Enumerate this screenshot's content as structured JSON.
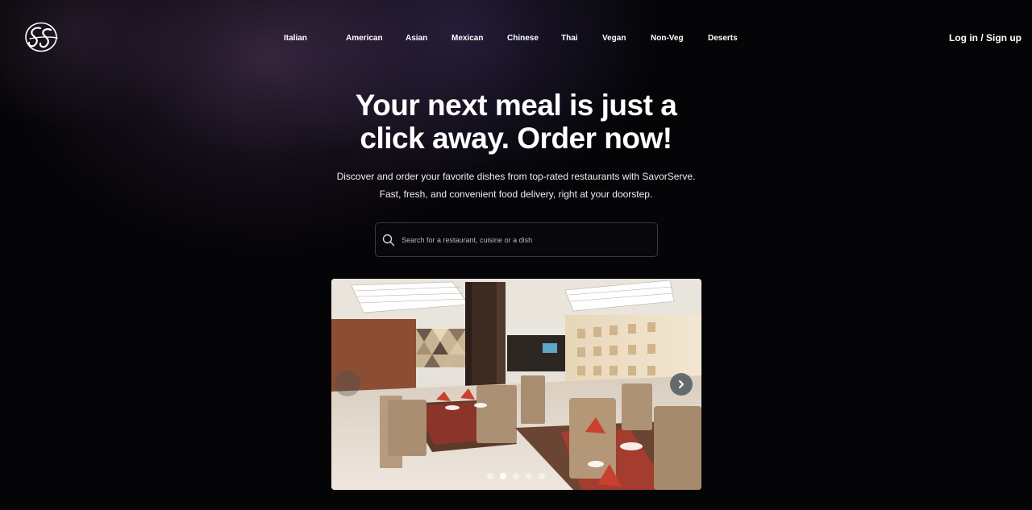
{
  "brand": {
    "logo_icon": "script-ss-logo-icon"
  },
  "nav": {
    "links": [
      "Italian",
      "American",
      "Asian",
      "Mexican",
      "Chinese",
      "Thai",
      "Vegan",
      "Non-Veg",
      "Deserts"
    ],
    "login_label": "Log in / Sign up"
  },
  "hero": {
    "title_line1": "Your next meal is just a",
    "title_line2": "click away. Order now!",
    "subtitle_line1": "Discover and order your favorite dishes from top-rated restaurants with SavorServe.",
    "subtitle_line2": "Fast, fresh, and convenient food delivery, right at your doorstep."
  },
  "search": {
    "placeholder": "Search for a restaurant, cuisine or a dish",
    "value": "",
    "icon": "search-icon"
  },
  "carousel": {
    "slide_count": 5,
    "active_index": 1,
    "next_icon": "chevron-right-icon",
    "prev_icon": "chevron-left-icon"
  },
  "colors": {
    "background": "#050407",
    "glow": "#5c4068",
    "text": "#ffffff",
    "search_border": "#3a3840"
  }
}
